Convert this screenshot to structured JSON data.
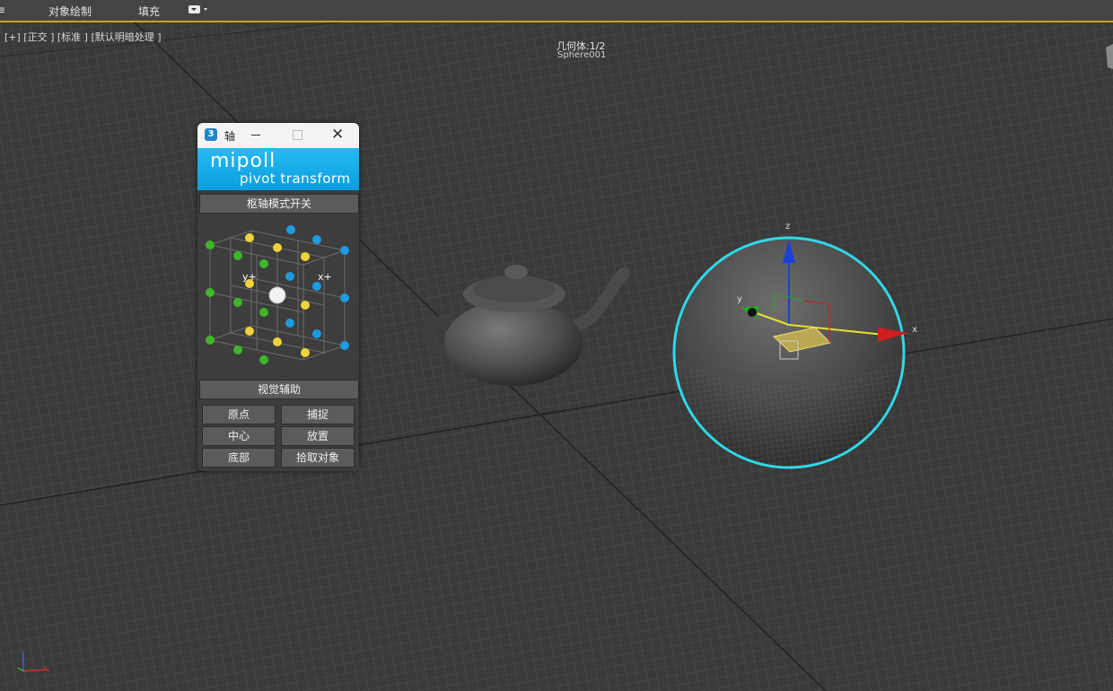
{
  "toolbar": {
    "edge_label": "≡",
    "object_paint_label": "对象绘制",
    "fill_label": "填充"
  },
  "viewport": {
    "label": "[+] [正交 ] [标准 ] [默认明暗处理 ]",
    "geometry_count": "几何体:1/2",
    "selected_object": "Sphere001",
    "gizmo_axes": {
      "x": "x",
      "y": "y",
      "z": "z"
    }
  },
  "dialog": {
    "title": "轴",
    "app_icon_text": "3",
    "brand_line1": "mipoll",
    "brand_line2": "pivot transform",
    "pivot_toggle_label": "枢轴模式开关",
    "cube_labels": {
      "y_plus": "y+",
      "x_plus": "x+"
    },
    "visual_aid_label": "视觉辅助",
    "buttons": {
      "origin": "原点",
      "snap": "捕捉",
      "center": "中心",
      "place": "放置",
      "bottom": "底部",
      "pick_object": "拾取对象"
    }
  },
  "colors": {
    "viewport_bg": "#3a3a3a",
    "grid_line": "#4d4d4d",
    "selection_outline": "#2fd8e8",
    "banner": "#17a9e8",
    "accent_border": "#c9a227",
    "node_green": "#3fb52a",
    "node_yellow": "#f0d23a",
    "node_blue": "#1e9be0"
  }
}
